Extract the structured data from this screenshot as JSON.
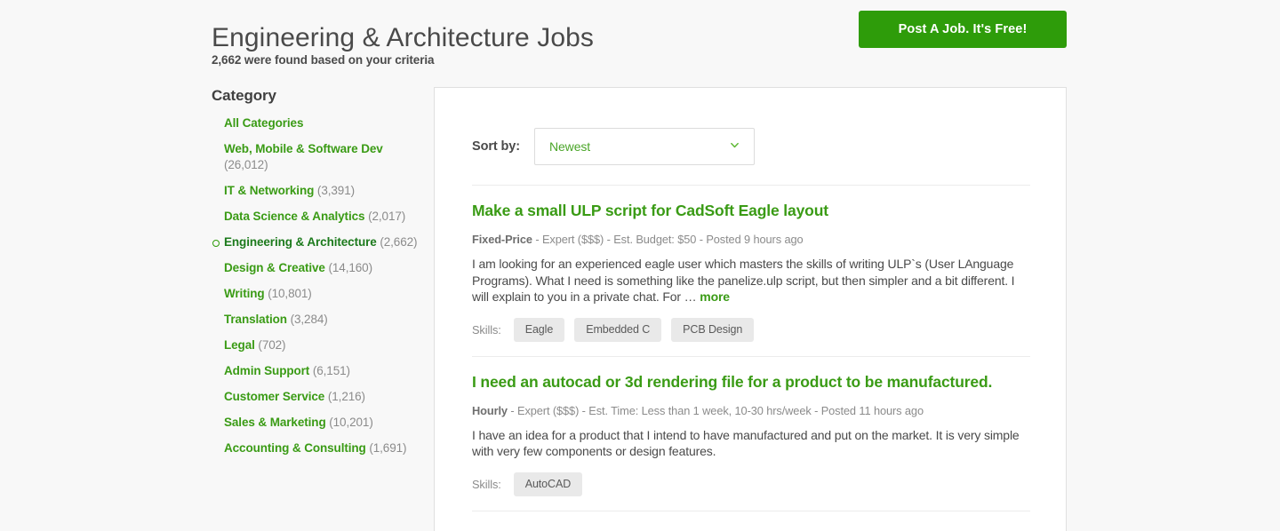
{
  "header": {
    "title": "Engineering & Architecture Jobs",
    "result_count": "2,662 were found based on your criteria",
    "post_job_label": "Post A Job. It's Free!"
  },
  "colors": {
    "brand_green": "#2e9c0a",
    "link_green": "#3a9b15",
    "active_green": "#1c7a1c",
    "page_background": "#f8f8f8",
    "panel_background": "#ffffff",
    "tag_background": "#e9e9e9",
    "muted_text": "#8b8b8b"
  },
  "sidebar": {
    "heading": "Category",
    "items": [
      {
        "label": "All Categories",
        "count": "",
        "active": false
      },
      {
        "label": "Web, Mobile & Software Dev",
        "count": "(26,012)",
        "active": false
      },
      {
        "label": "IT & Networking",
        "count": "(3,391)",
        "active": false
      },
      {
        "label": "Data Science & Analytics",
        "count": "(2,017)",
        "active": false
      },
      {
        "label": "Engineering & Architecture",
        "count": "(2,662)",
        "active": true
      },
      {
        "label": "Design & Creative",
        "count": "(14,160)",
        "active": false
      },
      {
        "label": "Writing",
        "count": "(10,801)",
        "active": false
      },
      {
        "label": "Translation",
        "count": "(3,284)",
        "active": false
      },
      {
        "label": "Legal",
        "count": "(702)",
        "active": false
      },
      {
        "label": "Admin Support",
        "count": "(6,151)",
        "active": false
      },
      {
        "label": "Customer Service",
        "count": "(1,216)",
        "active": false
      },
      {
        "label": "Sales & Marketing",
        "count": "(10,201)",
        "active": false
      },
      {
        "label": "Accounting & Consulting",
        "count": "(1,691)",
        "active": false
      }
    ]
  },
  "main": {
    "sort": {
      "label": "Sort by:",
      "selected": "Newest",
      "icon": "chevron-down-icon"
    },
    "skills_label": "Skills:",
    "more_label": "more",
    "jobs": [
      {
        "title": "Make a small ULP script for CadSoft Eagle layout",
        "meta_bold": "Fixed-Price",
        "meta_rest": " - Expert ($$$) - Est. Budget: $50 - Posted 9 hours ago",
        "description": "I am looking for an experienced eagle user which masters the skills of writing ULP`s (User LAnguage Programs). What I need is something like the panelize.ulp script, but then simpler and a bit different. I will explain to you in a private chat. For … ",
        "skills": [
          "Eagle",
          "Embedded C",
          "PCB Design"
        ]
      },
      {
        "title": "I need an autocad or 3d rendering file for a product to be manufactured.",
        "meta_bold": "Hourly",
        "meta_rest": " - Expert ($$$) - Est. Time: Less than 1 week, 10-30 hrs/week - Posted 11 hours ago",
        "description": "I have an idea for a product that I intend to have manufactured and put on the market. It is very simple with very few components or design features.",
        "skills": [
          "AutoCAD"
        ]
      }
    ]
  }
}
